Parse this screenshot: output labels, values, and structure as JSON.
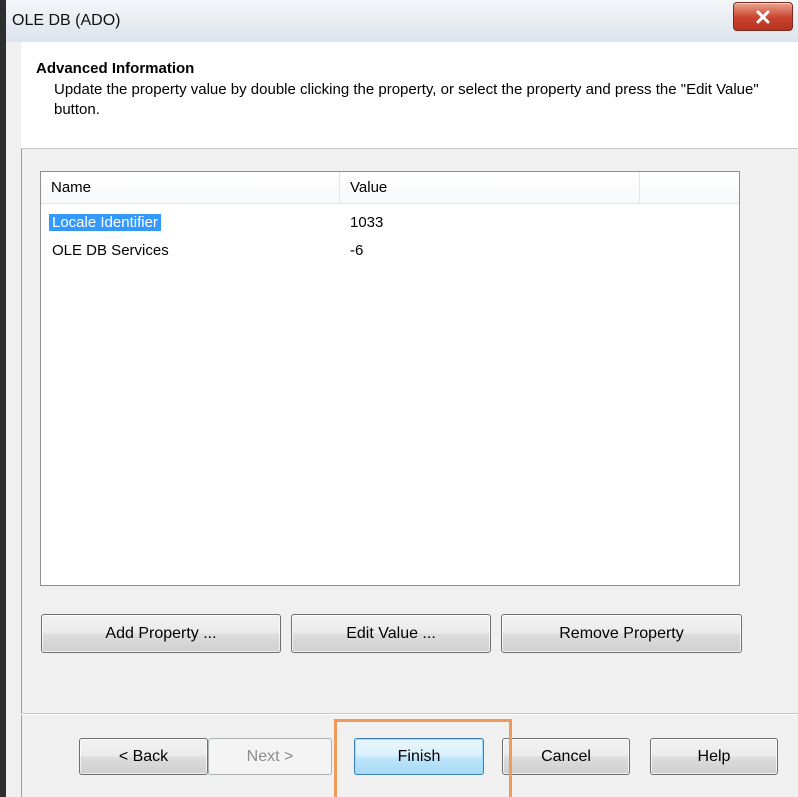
{
  "window": {
    "title": "OLE DB (ADO)"
  },
  "header": {
    "title": "Advanced Information",
    "description": "Update the property value by double clicking the property, or select the property and press the \"Edit Value\" button."
  },
  "properties_list": {
    "columns": [
      "Name",
      "Value"
    ],
    "rows": [
      {
        "name": "Locale Identifier",
        "value": "1033"
      },
      {
        "name": "OLE DB Services",
        "value": "-6"
      }
    ]
  },
  "property_buttons": {
    "add": "Add Property ...",
    "edit": "Edit Value ...",
    "remove": "Remove Property"
  },
  "nav_buttons": {
    "back": "< Back",
    "next": "Next >",
    "finish": "Finish",
    "cancel": "Cancel",
    "help": "Help"
  },
  "colors": {
    "selection": "#3399ff",
    "highlight_outline": "#ee9a5b",
    "close_button": "#c9432e"
  }
}
